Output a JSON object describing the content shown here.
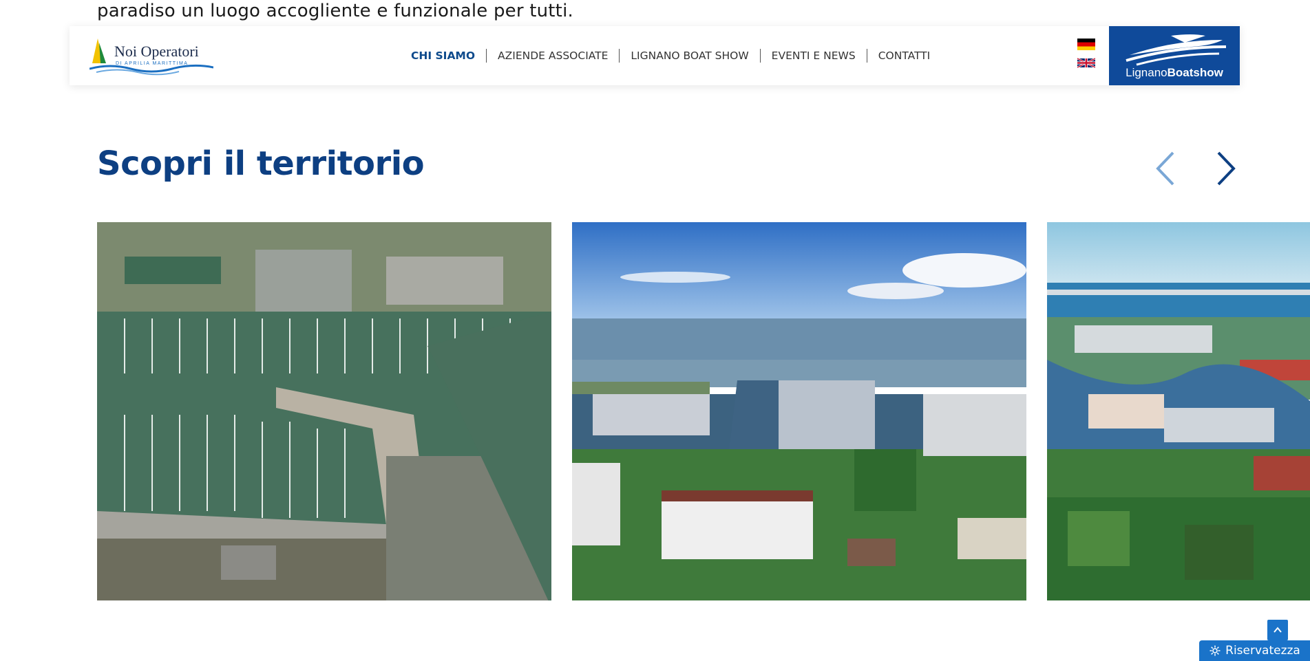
{
  "intro": {
    "text": "paradiso un luogo accogliente e funzionale per tutti."
  },
  "header": {
    "logo": {
      "name": "Noi Operatori",
      "subtitle": "DI APRILIA MARITTIMA"
    },
    "nav": [
      {
        "label": "CHI SIAMO",
        "active": true
      },
      {
        "label": "AZIENDE ASSOCIATE",
        "active": false
      },
      {
        "label": "LIGNANO BOAT SHOW",
        "active": false
      },
      {
        "label": "EVENTI E NEWS",
        "active": false
      },
      {
        "label": "CONTATTI",
        "active": false
      }
    ],
    "languages": [
      {
        "icon": "flag-de-icon"
      },
      {
        "icon": "flag-uk-icon"
      }
    ],
    "boatshow": {
      "light": "Lignano",
      "bold": "Boatshow",
      "icon": "yacht-icon",
      "color": "#0f4a9a"
    }
  },
  "section": {
    "title": "Scopri il territorio",
    "prev_icon": "chevron-left-icon",
    "next_icon": "chevron-right-icon"
  },
  "gallery": [
    {
      "icon": "marina-aerial-photo"
    },
    {
      "icon": "lagoon-marina-photo"
    },
    {
      "icon": "harbor-coast-photo"
    }
  ],
  "footer": {
    "scroll_top_icon": "chevron-up-icon",
    "privacy_label": "Riservatezza",
    "privacy_icon": "gear-icon"
  },
  "colors": {
    "primary": "#0d3f82",
    "accent": "#1a73c9"
  }
}
